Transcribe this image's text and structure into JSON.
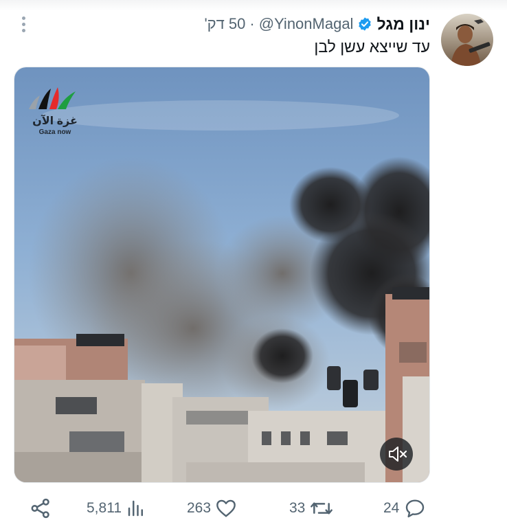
{
  "tweet": {
    "display_name": "ינון מגל",
    "handle": "@YinonMagal",
    "separator": "·",
    "timestamp": "50 דק'",
    "text": "עד שייצא עשן לבן",
    "verified_icon": "verified-badge-icon",
    "avatar": "profile-avatar"
  },
  "media": {
    "type": "video",
    "watermark_ar": "غزة الآن",
    "watermark_en": "Gaza now",
    "mute_icon": "volume-muted-icon"
  },
  "actions": {
    "share_icon": "share-icon",
    "views": "5,811",
    "views_icon": "analytics-bars-icon",
    "likes": "263",
    "likes_icon": "heart-icon",
    "retweets": "33",
    "retweets_icon": "retweet-icon",
    "replies": "24",
    "replies_icon": "reply-bubble-icon"
  },
  "colors": {
    "verified": "#1d9bf0",
    "secondary_text": "#536471",
    "primary_text": "#0f1419"
  }
}
